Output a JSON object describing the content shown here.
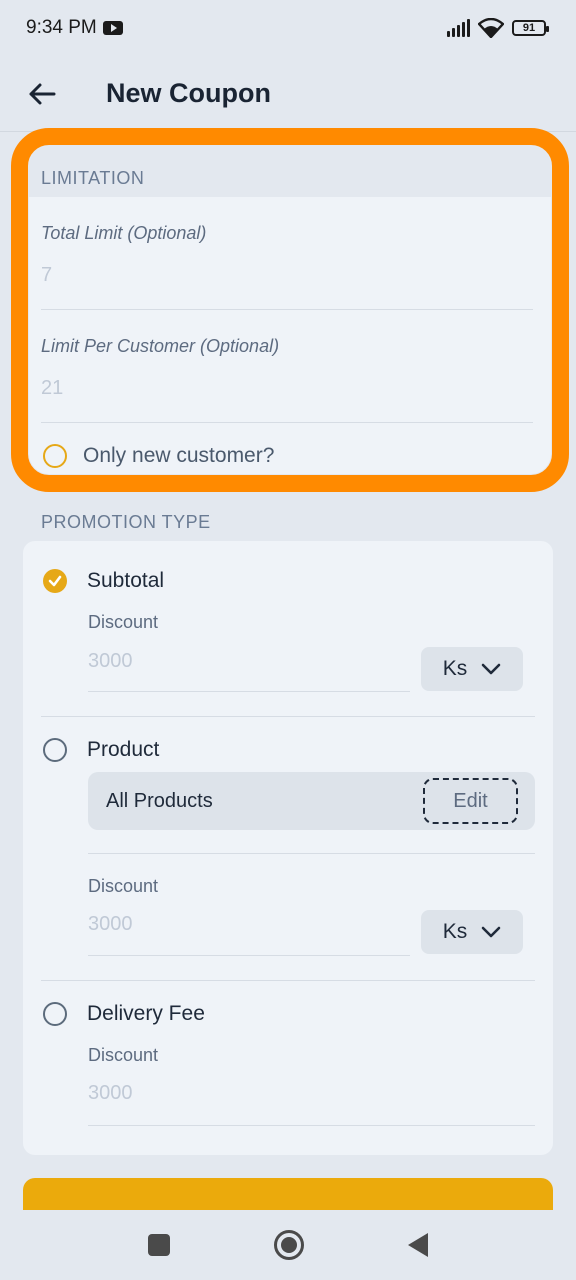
{
  "status_bar": {
    "time": "9:34 PM",
    "battery": "91"
  },
  "header": {
    "title": "New Coupon"
  },
  "limitation": {
    "section_title": "LIMITATION",
    "total_limit_label": "Total Limit (Optional)",
    "total_limit_value": "7",
    "limit_per_customer_label": "Limit Per Customer (Optional)",
    "limit_per_customer_value": "21",
    "only_new_customer_label": "Only new customer?"
  },
  "promotion": {
    "section_title": "PROMOTION TYPE",
    "subtotal": {
      "label": "Subtotal",
      "discount_label": "Discount",
      "discount_value": "3000",
      "currency": "Ks",
      "selected": true
    },
    "product": {
      "label": "Product",
      "products_label": "All Products",
      "edit_label": "Edit",
      "discount_label": "Discount",
      "discount_value": "3000",
      "currency": "Ks",
      "selected": false
    },
    "delivery": {
      "label": "Delivery Fee",
      "discount_label": "Discount",
      "discount_value": "3000",
      "selected": false
    }
  },
  "colors": {
    "accent": "#ff8a00",
    "primary": "#ebaa0c",
    "background": "#e3e8ef",
    "card": "#eff3f8"
  },
  "icons": [
    "youtube-icon",
    "signal-icon",
    "wifi-icon",
    "battery-icon",
    "back-arrow-icon",
    "check-icon",
    "chevron-down-icon",
    "nav-recents-icon",
    "nav-home-icon",
    "nav-back-icon"
  ]
}
